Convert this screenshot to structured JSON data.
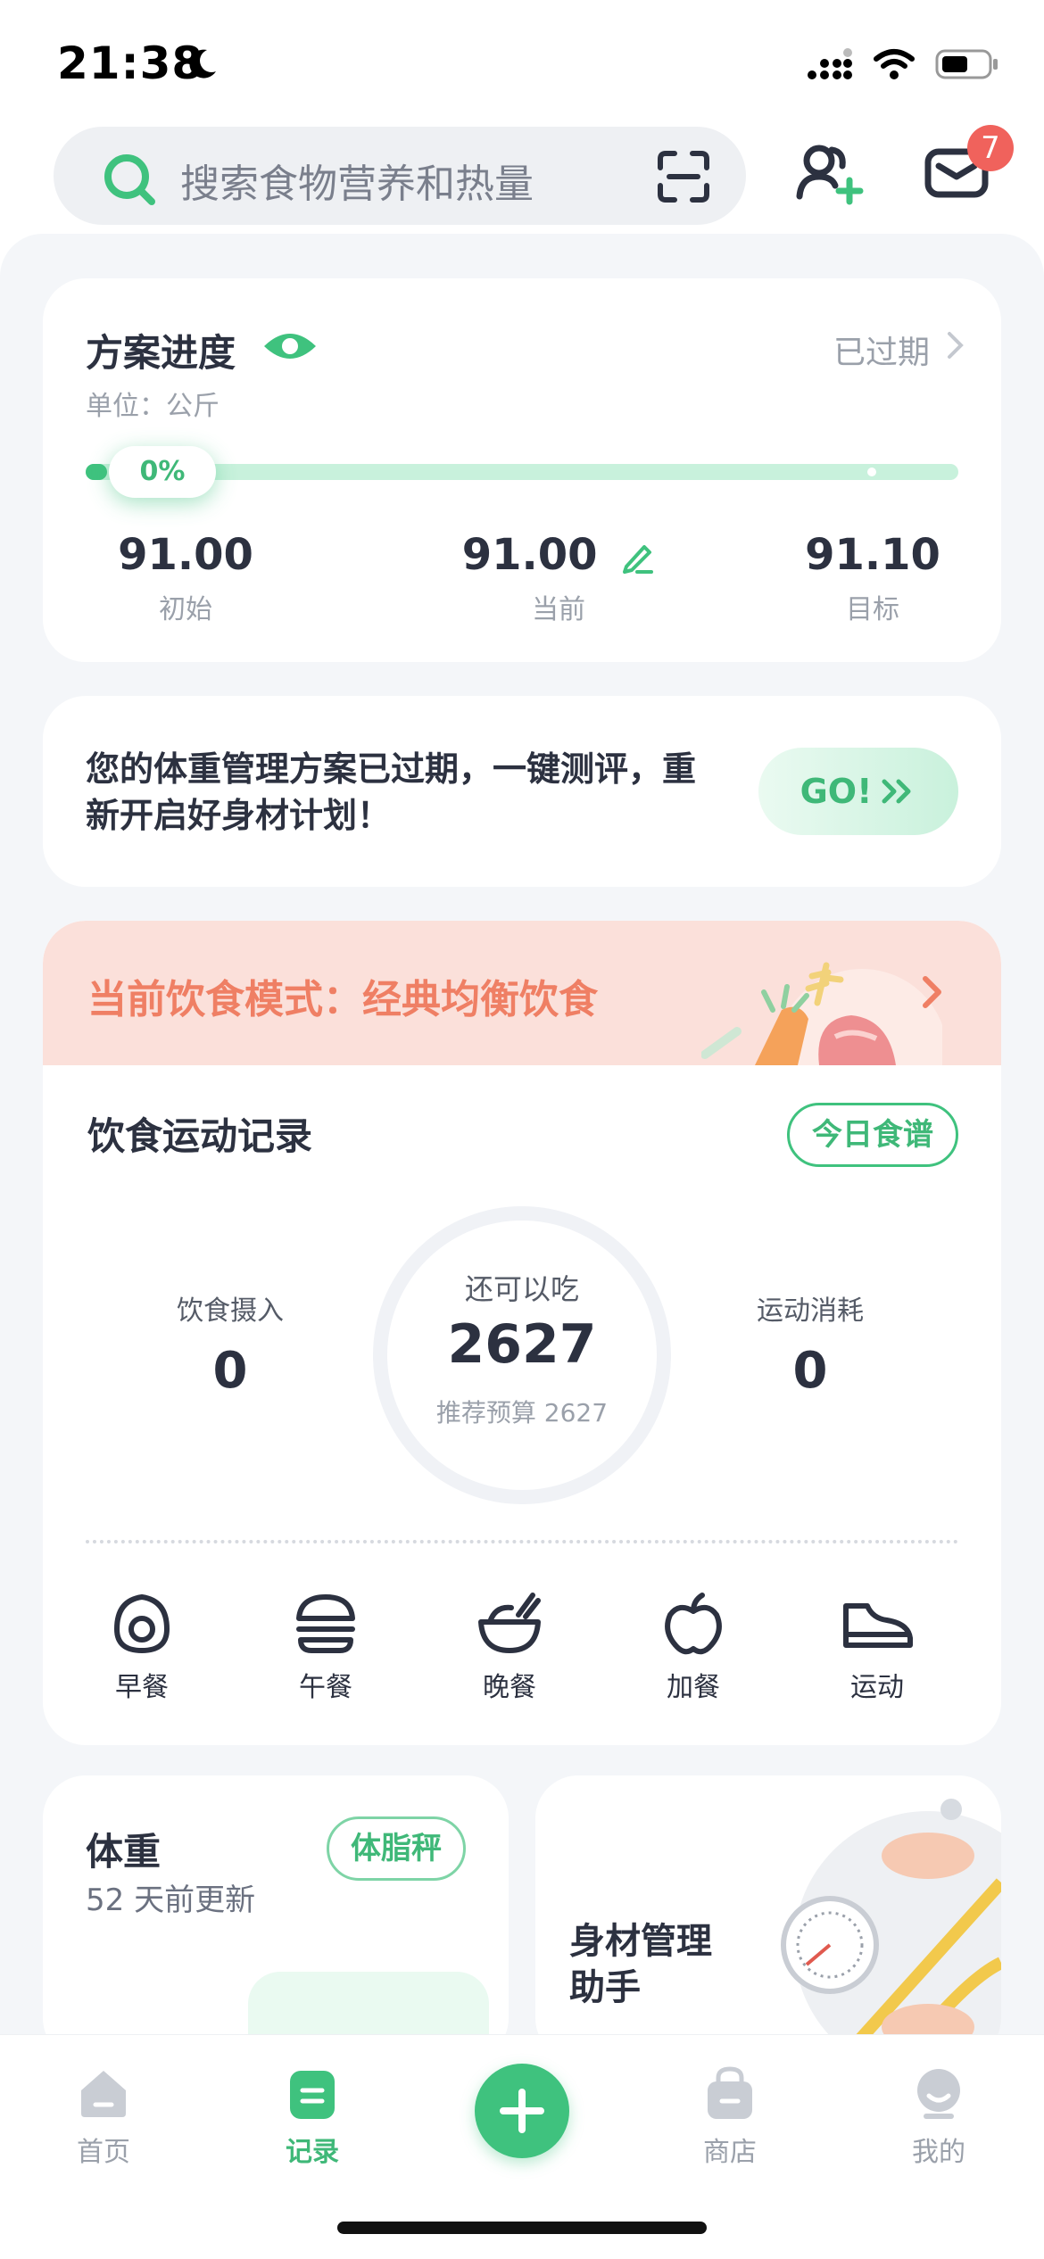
{
  "status_bar": {
    "time": "21:38"
  },
  "search": {
    "placeholder": "搜索食物营养和热量"
  },
  "header": {
    "mail_badge_count": "7"
  },
  "plan": {
    "title": "方案进度",
    "status": "已过期",
    "unit": "单位：公斤",
    "progress_percent": "0%",
    "initial_value": "91.00",
    "initial_label": "初始",
    "current_value": "91.00",
    "current_label": "当前",
    "target_value": "91.10",
    "target_label": "目标"
  },
  "expired_notice": {
    "text": "您的体重管理方案已过期，一键测评，重新开启好身材计划！",
    "button_label": "GO!"
  },
  "diet": {
    "mode_text": "当前饮食模式：经典均衡饮食",
    "record_title": "饮食运动记录",
    "recipe_button": "今日食谱",
    "intake_label": "饮食摄入",
    "intake_value": "0",
    "remaining_label": "还可以吃",
    "remaining_value": "2627",
    "budget_text": "推荐预算 2627",
    "burn_label": "运动消耗",
    "burn_value": "0",
    "meals": [
      {
        "label": "早餐",
        "icon": "egg-icon"
      },
      {
        "label": "午餐",
        "icon": "burger-icon"
      },
      {
        "label": "晚餐",
        "icon": "bowl-icon"
      },
      {
        "label": "加餐",
        "icon": "apple-icon"
      },
      {
        "label": "运动",
        "icon": "sneaker-icon"
      }
    ]
  },
  "weight_card": {
    "title": "体重",
    "updated": "52 天前更新",
    "button": "体脂秤"
  },
  "body_card": {
    "title": "身材管理助手"
  },
  "tabs": [
    {
      "label": "首页",
      "icon": "home-icon",
      "active": false
    },
    {
      "label": "记录",
      "icon": "record-icon",
      "active": true
    },
    {
      "label": "商店",
      "icon": "shop-bag-icon",
      "active": false
    },
    {
      "label": "我的",
      "icon": "profile-icon",
      "active": false
    }
  ],
  "colors": {
    "accent": "#3FC27E",
    "diet_banner": "#FBE0DA",
    "diet_text": "#EF7F64",
    "badge": "#F0625C"
  }
}
